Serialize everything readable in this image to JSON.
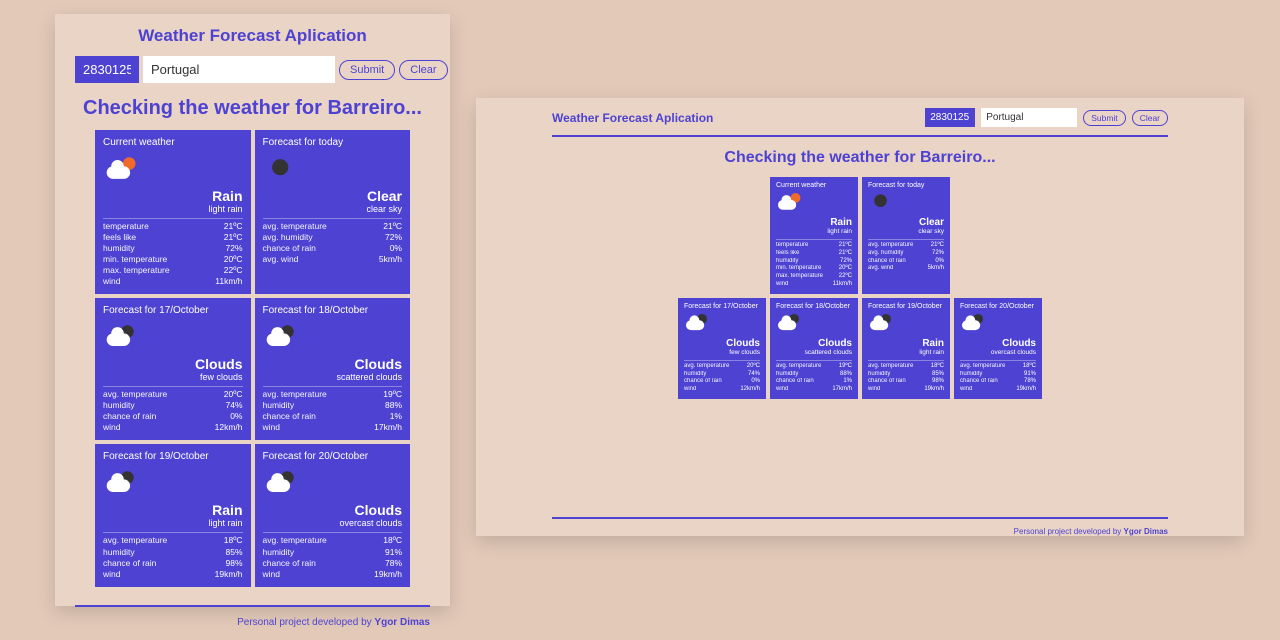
{
  "app_title": "Weather Forecast Aplication",
  "inputs": {
    "zip": "2830125",
    "country": "Portugal",
    "submit": "Submit",
    "clear": "Clear"
  },
  "checking": "Checking the weather for Barreiro...",
  "current": {
    "title": "Current weather",
    "cond": "Rain",
    "desc": "light rain",
    "icon": "sun-cloud",
    "rows": [
      [
        "temperature",
        "21ºC"
      ],
      [
        "feels like",
        "21ºC"
      ],
      [
        "humidity",
        "72%"
      ],
      [
        "min. temperature",
        "20ºC"
      ],
      [
        "max. temperature",
        "22ºC"
      ],
      [
        "wind",
        "11km/h"
      ]
    ]
  },
  "today": {
    "title": "Forecast for today",
    "cond": "Clear",
    "desc": "clear sky",
    "icon": "moon-only",
    "rows": [
      [
        "avg. temperature",
        "21ºC"
      ],
      [
        "avg. humidity",
        "72%"
      ],
      [
        "chance of rain",
        "0%"
      ],
      [
        "avg. wind",
        "5km/h"
      ]
    ]
  },
  "days": [
    {
      "title": "Forecast for 17/October",
      "cond": "Clouds",
      "desc": "few clouds",
      "icon": "moon-cloud",
      "rows": [
        [
          "avg. temperature",
          "20ºC"
        ],
        [
          "humidity",
          "74%"
        ],
        [
          "chance of rain",
          "0%"
        ],
        [
          "wind",
          "12km/h"
        ]
      ]
    },
    {
      "title": "Forecast for 18/October",
      "cond": "Clouds",
      "desc": "scattered clouds",
      "icon": "moon-cloud",
      "rows": [
        [
          "avg. temperature",
          "19ºC"
        ],
        [
          "humidity",
          "88%"
        ],
        [
          "chance of rain",
          "1%"
        ],
        [
          "wind",
          "17km/h"
        ]
      ]
    },
    {
      "title": "Forecast for 19/October",
      "cond": "Rain",
      "desc": "light rain",
      "icon": "moon-cloud",
      "rows": [
        [
          "avg. temperature",
          "18ºC"
        ],
        [
          "humidity",
          "85%"
        ],
        [
          "chance of rain",
          "98%"
        ],
        [
          "wind",
          "19km/h"
        ]
      ]
    },
    {
      "title": "Forecast for 20/October",
      "cond": "Clouds",
      "desc": "overcast clouds",
      "icon": "moon-cloud",
      "rows": [
        [
          "avg. temperature",
          "18ºC"
        ],
        [
          "humidity",
          "91%"
        ],
        [
          "chance of rain",
          "78%"
        ],
        [
          "wind",
          "19km/h"
        ]
      ]
    }
  ],
  "footer_prefix": "Personal project developed by ",
  "footer_author": "Ygor Dimas"
}
